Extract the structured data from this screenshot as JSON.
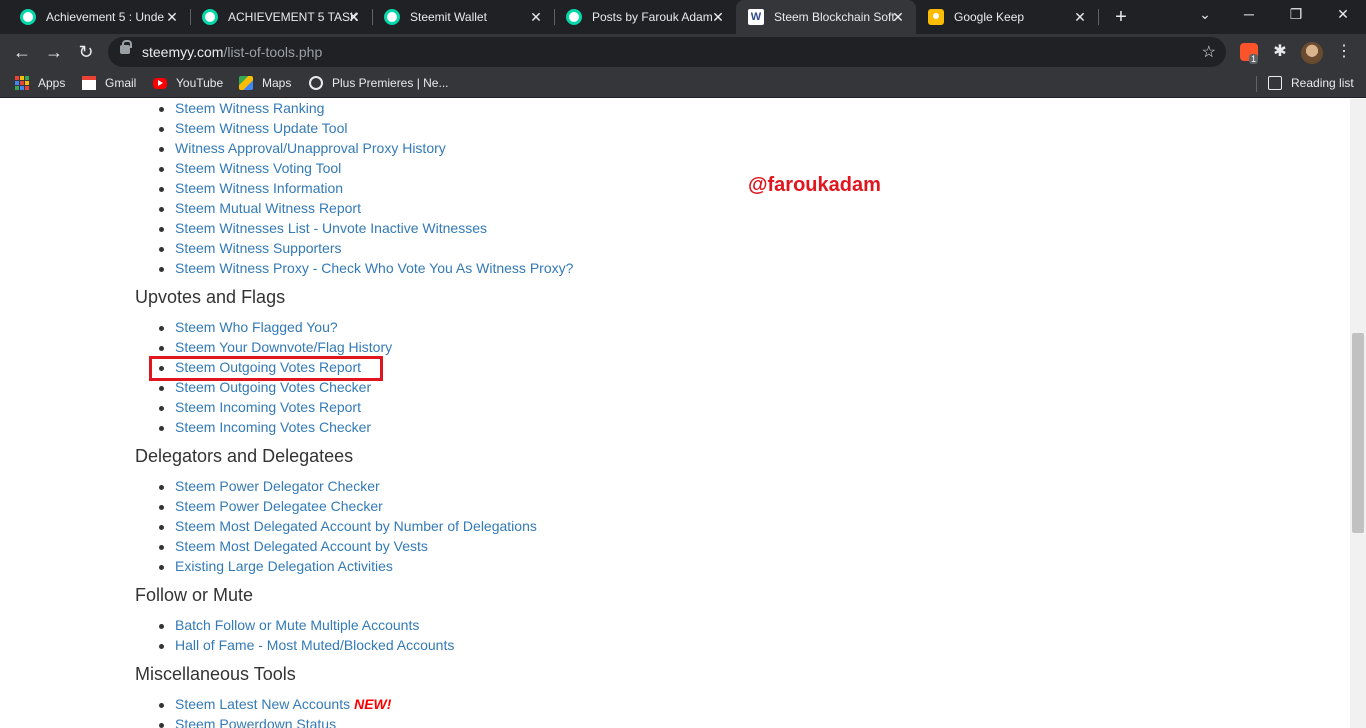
{
  "browser": {
    "tabs": [
      {
        "title": "Achievement 5 : Unde",
        "favicon": "steemit-icon"
      },
      {
        "title": "ACHIEVEMENT 5 TASK",
        "favicon": "steemit-icon"
      },
      {
        "title": "Steemit Wallet",
        "favicon": "steemit-icon"
      },
      {
        "title": "Posts by Farouk Adam",
        "favicon": "steemit-icon"
      },
      {
        "title": "Steem Blockchain Soft",
        "favicon": "steemyy-icon",
        "active": true
      },
      {
        "title": "Google Keep",
        "favicon": "keep-icon"
      }
    ],
    "url_host": "steemyy.com",
    "url_path": "/list-of-tools.php",
    "extension_badge": "1",
    "bookmarks": [
      "Apps",
      "Gmail",
      "YouTube",
      "Maps",
      "Plus Premieres | Ne..."
    ],
    "reading_list": "Reading list"
  },
  "page": {
    "watermark": "@faroukadam",
    "new_badge": "NEW!",
    "witness_items": [
      "Steem Witness Ranking",
      "Steem Witness Update Tool",
      "Witness Approval/Unapproval Proxy History",
      "Steem Witness Voting Tool",
      "Steem Witness Information",
      "Steem Mutual Witness Report",
      "Steem Witnesses List - Unvote Inactive Witnesses",
      "Steem Witness Supporters",
      "Steem Witness Proxy - Check Who Vote You As Witness Proxy?"
    ],
    "upvotes_heading": "Upvotes and Flags",
    "upvotes_items": [
      "Steem Who Flagged You?",
      "Steem Your Downvote/Flag History",
      "Steem Outgoing Votes Report",
      "Steem Outgoing Votes Checker",
      "Steem Incoming Votes Report",
      "Steem Incoming Votes Checker"
    ],
    "delegators_heading": "Delegators and Delegatees",
    "delegators_items": [
      "Steem Power Delegator Checker",
      "Steem Power Delegatee Checker",
      "Steem Most Delegated Account by Number of Delegations",
      "Steem Most Delegated Account by Vests",
      "Existing Large Delegation Activities"
    ],
    "follow_heading": "Follow or Mute",
    "follow_items": [
      "Batch Follow or Mute Multiple Accounts",
      "Hall of Fame - Most Muted/Blocked Accounts"
    ],
    "misc_heading": "Miscellaneous Tools",
    "misc_items": [
      "Steem Latest New Accounts",
      "Steem Powerdown Status"
    ]
  },
  "colors": {
    "link": "#337ab7",
    "heading": "#333333",
    "highlight": "#e0151d",
    "chrome_dark": "#202124",
    "chrome_toolbar": "#35363a"
  }
}
